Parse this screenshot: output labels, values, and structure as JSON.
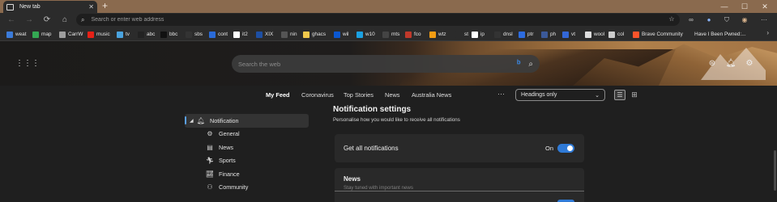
{
  "browser": {
    "tab_title": "New tab",
    "tab_close": "✕",
    "new_tab": "+",
    "window": {
      "minimize": "—",
      "maximize": "☐",
      "close": "✕"
    },
    "address_placeholder": "Search or enter web address"
  },
  "bookmarks": [
    {
      "label": "weat",
      "color": "#3b7bd9"
    },
    {
      "label": "map",
      "color": "#34a853"
    },
    {
      "label": "CarrW",
      "color": "#9e9e9e"
    },
    {
      "label": "music",
      "color": "#e62117"
    },
    {
      "label": "tv",
      "color": "#4aa3df"
    },
    {
      "label": "abc",
      "color": "#222222"
    },
    {
      "label": "bbc",
      "color": "#111111"
    },
    {
      "label": "sbs",
      "color": "#333333"
    },
    {
      "label": "cont",
      "color": "#2a6bd8"
    },
    {
      "label": "it2",
      "color": "#ffffff"
    },
    {
      "label": "XIX",
      "color": "#1d4fa3"
    },
    {
      "label": "nin",
      "color": "#555555"
    },
    {
      "label": "ghacs",
      "color": "#f2c94c"
    },
    {
      "label": "wil",
      "color": "#0b57d0"
    },
    {
      "label": "w10",
      "color": "#1ba1e2"
    },
    {
      "label": "mts",
      "color": "#444444"
    },
    {
      "label": "fco",
      "color": "#c0392b"
    },
    {
      "label": "wtz",
      "color": "#f39c12"
    },
    {
      "label": "st",
      "color": "#2b2b2b"
    },
    {
      "label": "ip",
      "color": "#ffffff"
    },
    {
      "label": "dnsl",
      "color": "#333333"
    },
    {
      "label": "ptr",
      "color": "#2d6cdf"
    },
    {
      "label": "ph",
      "color": "#3b5998"
    },
    {
      "label": "vt",
      "color": "#3367d6"
    },
    {
      "label": "wool",
      "color": "#dddddd"
    },
    {
      "label": "col",
      "color": "#cccccc"
    },
    {
      "label": "Brave Community",
      "color": "#fb542b"
    },
    {
      "label": "Have I Been Pwned:...",
      "color": "#2b2b2b"
    }
  ],
  "hero": {
    "search_placeholder": "Search the web"
  },
  "feed_nav": {
    "tabs": [
      "My Feed",
      "Coronavirus",
      "Top Stories",
      "News",
      "Australia News"
    ],
    "active_tab": "My Feed",
    "more": "···",
    "layout_select": "Headings only"
  },
  "sidebar": {
    "items": [
      {
        "label": "Notification",
        "icon": "bell-icon",
        "active": true
      },
      {
        "label": "General",
        "icon": "gear-icon"
      },
      {
        "label": "News",
        "icon": "newspaper-icon"
      },
      {
        "label": "Sports",
        "icon": "running-icon"
      },
      {
        "label": "Finance",
        "icon": "chart-icon"
      },
      {
        "label": "Community",
        "icon": "community-icon"
      }
    ]
  },
  "settings": {
    "title": "Notification settings",
    "subtitle": "Personalise how you would like to receive all notifications",
    "all_label": "Get all notifications",
    "all_state": "On",
    "all_enabled": true,
    "news_label": "News",
    "news_sub": "Stay tuned with important news"
  },
  "colors": {
    "accent": "#2f7ad6",
    "active_marker": "#5aa1f2",
    "background": "#1f1f1f",
    "card": "#292929"
  }
}
